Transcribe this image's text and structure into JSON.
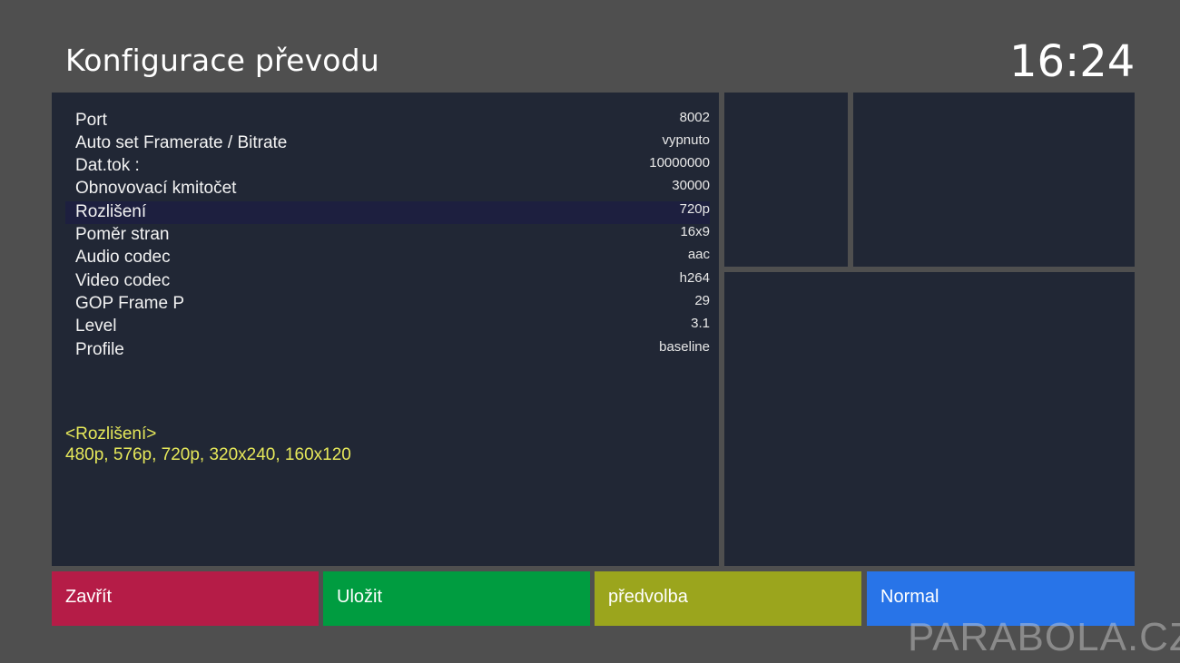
{
  "header": {
    "title": "Konfigurace převodu",
    "clock": "16:24"
  },
  "settings": [
    {
      "label": "Port",
      "value": "8002"
    },
    {
      "label": "Auto set Framerate / Bitrate",
      "value": "vypnuto"
    },
    {
      "label": "Dat.tok :",
      "value": "10000000"
    },
    {
      "label": "Obnovovací kmitočet",
      "value": "30000"
    },
    {
      "label": "Rozlišení",
      "value": "720p",
      "selected": true
    },
    {
      "label": "Poměr stran",
      "value": "16x9"
    },
    {
      "label": "Audio codec",
      "value": "aac"
    },
    {
      "label": "Video codec",
      "value": "h264"
    },
    {
      "label": "GOP Frame P",
      "value": "29"
    },
    {
      "label": "Level",
      "value": "3.1"
    },
    {
      "label": "Profile",
      "value": "baseline"
    }
  ],
  "hint": {
    "title": "<Rozlišení>",
    "options": "480p, 576p, 720p, 320x240, 160x120"
  },
  "buttons": {
    "red": "Zavřít",
    "green": "Uložit",
    "yellow": "předvolba",
    "blue": "Normal"
  },
  "watermark": "PARABOLA.CZ",
  "colors": {
    "background": "#4f4f4f",
    "panel": "#212735",
    "selection": "#1d1f3f",
    "hint_text": "#e6e85a",
    "red": "#b51c47",
    "green": "#009c40",
    "yellow": "#9ba51d",
    "blue": "#2874e8"
  }
}
